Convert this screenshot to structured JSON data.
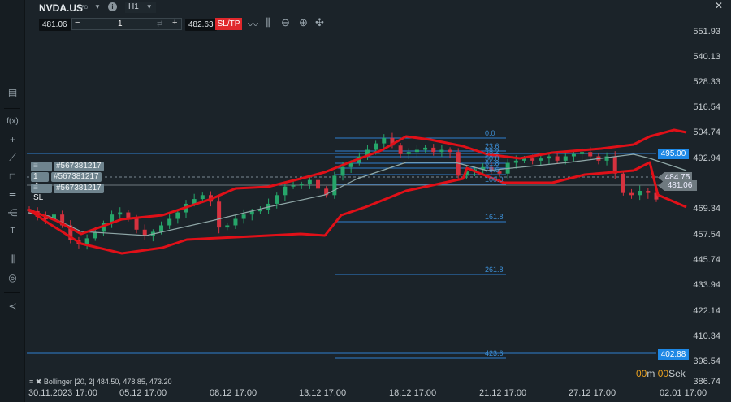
{
  "header": {
    "symbol": "NVDA.US",
    "instrument_type": "CFD",
    "timeframe": "H1",
    "bid": "481.06",
    "ask": "482.63",
    "quantity": "1",
    "sltp_label": "SL/TP"
  },
  "toolbar_icons": [
    "line-chart-icon",
    "indicators-icon",
    "zoom-out-icon",
    "zoom-in-icon",
    "crosshair-icon"
  ],
  "left_tools": [
    "layout-icon",
    "function-icon",
    "crosshair-icon",
    "trendline-icon",
    "rectangle-icon",
    "fibonacci-icon",
    "pitchfork-icon",
    "text-icon",
    "indicator-settings-icon",
    "layers-icon",
    "share-icon"
  ],
  "left_tool_labels": {
    "function": "f(x)",
    "text": "T"
  },
  "orders": {
    "tp_label": "TP",
    "tp_id": "#567381217",
    "position_qty": "1",
    "position_id": "#567381217",
    "sl_label": "SL",
    "sl_id": "#567381217"
  },
  "price_axis": [
    "551.93",
    "540.13",
    "528.33",
    "516.54",
    "504.74",
    "492.94",
    "469.34",
    "457.54",
    "445.74",
    "433.94",
    "422.14",
    "410.34",
    "398.54",
    "386.74"
  ],
  "price_tags": {
    "tp": "495.00",
    "ask": "484.75",
    "bid": "481.06",
    "sl": "402.88"
  },
  "fib_levels": [
    "0.0",
    "23.6",
    "38.2",
    "50.0",
    "61.8",
    "78.6",
    "100.0",
    "161.8",
    "261.8",
    "423.6"
  ],
  "dates": [
    "30.11.2023 17:00",
    "05.12 17:00",
    "08.12 17:00",
    "13.12 17:00",
    "18.12 17:00",
    "21.12 17:00",
    "27.12 17:00",
    "02.01 17:00"
  ],
  "indicator_legend": "Bollinger [20, 2] 484.50, 478.85, 473.20",
  "countdown": {
    "min": "00",
    "min_unit": "m",
    "sec": "00",
    "sec_unit": "Sek"
  },
  "colors": {
    "bull": "#26a66a",
    "bear": "#d6323f",
    "band": "#e01018",
    "middle": "#8fa7a7",
    "fib": "#2f7fd0",
    "tp_tag": "#1e88e5"
  },
  "closes": [
    468.6,
    466,
    464.8,
    467,
    462,
    455.4,
    453.5,
    456,
    459,
    463,
    467,
    468,
    465,
    460,
    457.3,
    459,
    462,
    465,
    468,
    472,
    474.2,
    476,
    473,
    461,
    462,
    465,
    467,
    468.5,
    469,
    472,
    476,
    480,
    480.5,
    481,
    483,
    479,
    476,
    485,
    489,
    491,
    494,
    497,
    500,
    502.5,
    499,
    495,
    496,
    497,
    498,
    496,
    497,
    496,
    485,
    487,
    488,
    489,
    487,
    486,
    491,
    492,
    493,
    492,
    493,
    494,
    492,
    494,
    495,
    496,
    494,
    492,
    494,
    486,
    477,
    476,
    478,
    477,
    474
  ]
}
